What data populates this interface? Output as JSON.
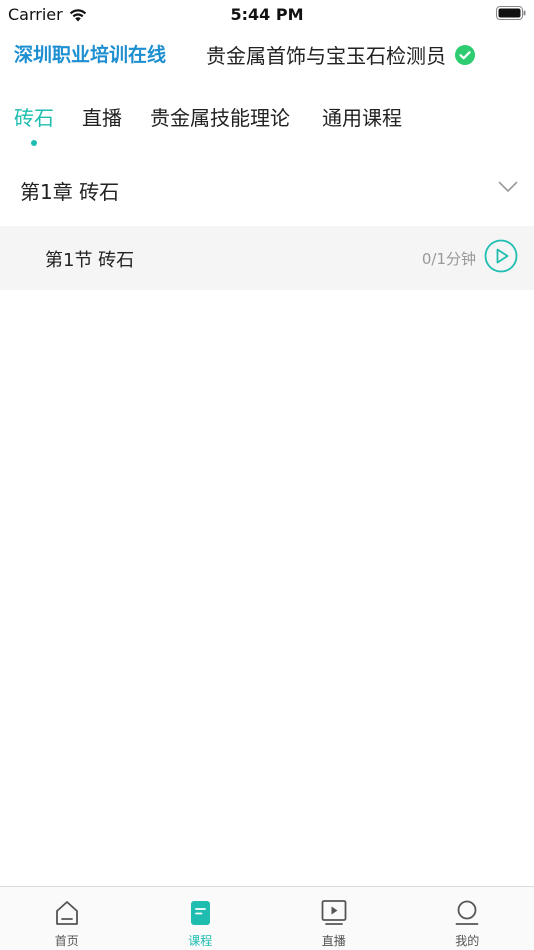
{
  "status_bar": {
    "carrier": "Carrier",
    "time": "5:44 PM"
  },
  "header": {
    "brand": "深圳职业培训在线",
    "course_title": "贵金属首饰与宝玉石检测员"
  },
  "tabs": [
    {
      "label": "砖石",
      "active": true
    },
    {
      "label": "直播",
      "active": false
    },
    {
      "label": "贵金属技能理论",
      "active": false
    },
    {
      "label": "通用课程",
      "active": false
    }
  ],
  "chapter": {
    "title": "第1章 砖石"
  },
  "section": {
    "title": "第1节 砖石",
    "duration": "0/1分钟"
  },
  "tabbar": {
    "items": [
      {
        "label": "首页",
        "icon": "home-icon",
        "active": false
      },
      {
        "label": "课程",
        "icon": "book-icon",
        "active": true
      },
      {
        "label": "直播",
        "icon": "live-icon",
        "active": false
      },
      {
        "label": "我的",
        "icon": "profile-icon",
        "active": false
      }
    ]
  },
  "colors": {
    "accent": "#1fbdb0",
    "brand": "#1d8fd0",
    "check": "#2ecc71"
  }
}
